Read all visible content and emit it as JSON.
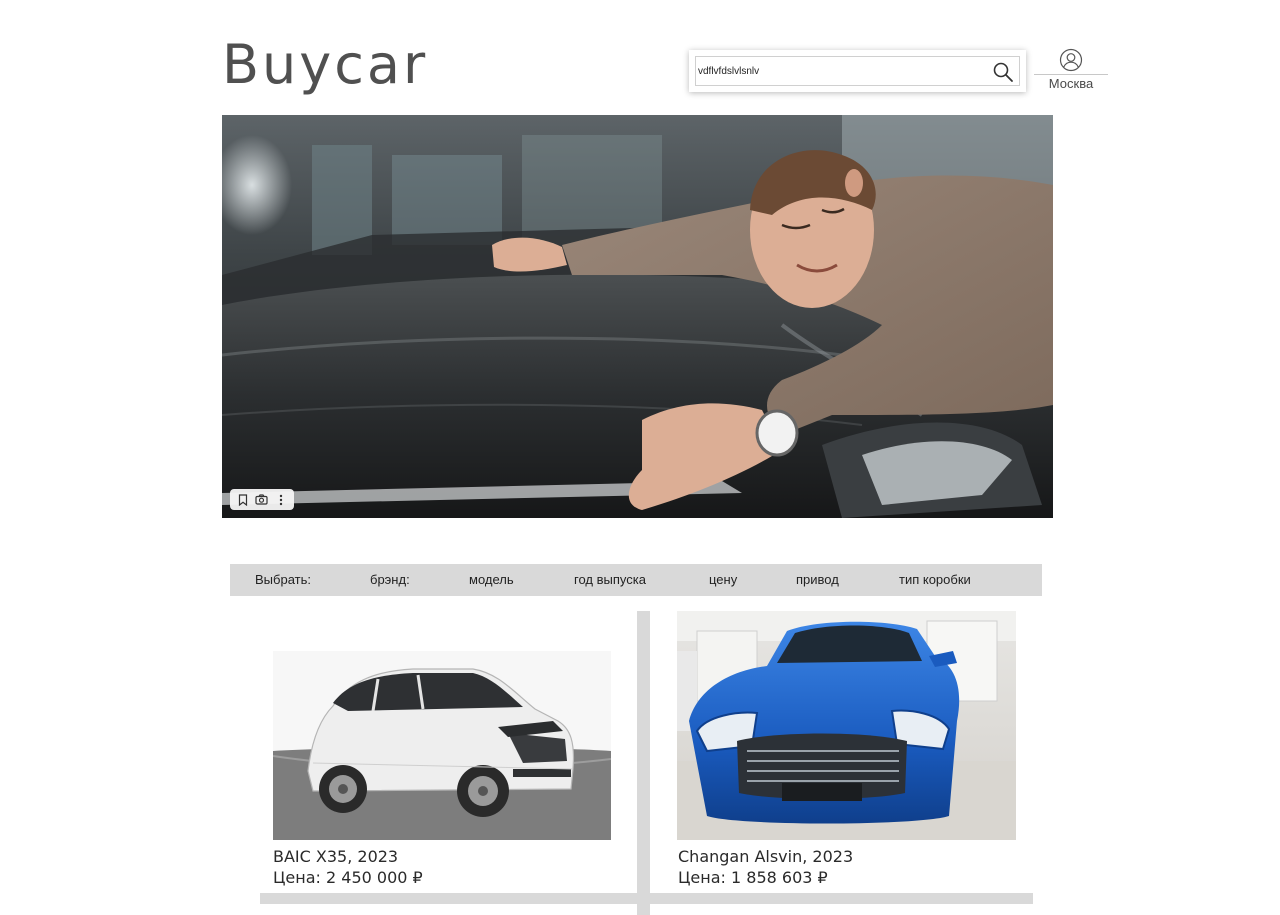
{
  "brand": {
    "logo_text": "Buycar"
  },
  "search": {
    "value": "vdflvfdslvlsnlv",
    "icon": "search-icon"
  },
  "account": {
    "icon": "user-circle-icon",
    "city": "Москва"
  },
  "hero": {
    "toolbar_icons": [
      "bookmark-icon",
      "camera-icon",
      "more-vertical-icon"
    ]
  },
  "filters": {
    "label": "Выбрать:",
    "items": [
      "брэнд:",
      "модель",
      "год выпуска",
      "цену",
      "привод",
      "тип коробки"
    ]
  },
  "cars": [
    {
      "title": "BAIC X35, 2023",
      "price": "Цена: 2 450 000 ₽",
      "color": "#f2f2f2"
    },
    {
      "title": "Changan Alsvin, 2023",
      "price": "Цена: 1 858 603 ₽",
      "color": "#1f5fc0"
    }
  ]
}
